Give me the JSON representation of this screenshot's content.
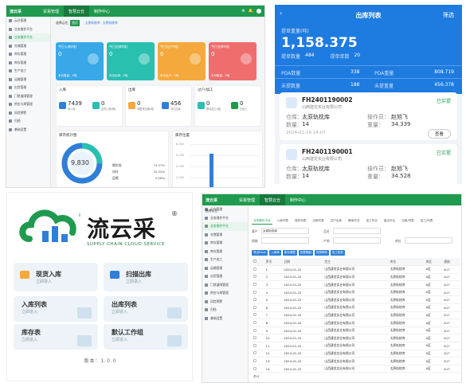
{
  "p1": {
    "logo": "流云采",
    "tabs": [
      "贸易管理",
      "智慧云仓",
      "制作中心"
    ],
    "breadcrumb": [
      "选择云仓",
      "首页"
    ],
    "wh_tabs": [
      "太原轨枕库",
      "太原轨枕库"
    ],
    "cards": [
      {
        "title": "今日入库(吨)",
        "value": "0",
        "sub": "本月数量：0吨",
        "color": "#38a8e8"
      },
      {
        "title": "今日出库(吨)",
        "value": "0",
        "sub": "本月出库：0吨",
        "color": "#29c0b0"
      },
      {
        "title": "今日出户(吨)",
        "value": "0",
        "sub": "本月出户：0吨",
        "color": "#f5a93c"
      },
      {
        "title": "今日仓库(吨)",
        "value": "0",
        "sub": "本月账量：0吨",
        "color": "#ee6e6e"
      }
    ],
    "sidebar": [
      "云仓管理",
      "业务操作平台",
      "业务操作平台",
      "仓储管理",
      "库存管理",
      "库存管理",
      "生产加工",
      "运输管理",
      "出货管理",
      "门禁道闸管理",
      "供应与周管理",
      "风险预警",
      "归档",
      "基础设置"
    ],
    "panels": [
      {
        "title": "入库",
        "stats": [
          {
            "v": "7439",
            "l": "待入库"
          },
          {
            "v": "0",
            "l": "交货入库(吨)"
          }
        ]
      },
      {
        "title": "出库",
        "stats": [
          {
            "v": "0",
            "l": "待提货出库(吨)"
          },
          {
            "v": "456",
            "l": "今日出库"
          }
        ]
      },
      {
        "title": "过户/加工",
        "stats": [
          {
            "v": "0",
            "l": "申请加工(吨)"
          },
          {
            "v": "0",
            "l": "已加工"
          }
        ]
      }
    ],
    "stock_title": "库存统计图",
    "stock_total": "9,830",
    "legend": [
      {
        "pct": "74.37%",
        "l": "螺纹钢"
      },
      {
        "pct": "25.54%",
        "l": "线材"
      },
      {
        "pct": "0.08%",
        "l": "盘螺"
      }
    ],
    "bar_title": "库存位置",
    "bar_ticks": [
      "8,000",
      "6,000",
      "4,000",
      "2,000"
    ]
  },
  "p2": {
    "title": "出库列表",
    "filter": "筛选",
    "weight_label": "提单重量(吨)",
    "weight": "1,158.375",
    "count_label": "提单数量",
    "count": "484",
    "sheets_label": "提单单数",
    "sheets": "20",
    "rows": [
      {
        "a_l": "PDA数量",
        "a": "338",
        "b_l": "PDA重量",
        "b": "808.719"
      },
      {
        "a_l": "未提数量",
        "a": "188",
        "b_l": "未提重量",
        "b": "456.378"
      }
    ],
    "records": [
      {
        "no": "FH2401190002",
        "status": "已实提",
        "company": "山西建龙实业有限公司",
        "wh_l": "仓库：",
        "wh": "太原轨枕库",
        "op_l": "操作员：",
        "op": "赵旭飞",
        "n_l": "数量：",
        "n": "14",
        "w_l": "重量：",
        "w": "34.339",
        "time": "2024-01-19 14:07",
        "btn": "查看"
      },
      {
        "no": "FH2401190001",
        "status": "已实提",
        "company": "山西建龙实业有限公司",
        "wh_l": "仓库：",
        "wh": "太原轨枕库",
        "op_l": "操作员：",
        "op": "赵旭飞",
        "n_l": "数量：",
        "n": "14",
        "w_l": "重量：",
        "w": "34.528"
      }
    ]
  },
  "p3": {
    "name": "流云采",
    "reg": "®",
    "tagline": "SUPPLY CHAIN CLOUD SERVICE",
    "tiles": [
      {
        "t": "现货入库",
        "s": "立即录入"
      },
      {
        "t": "扫描出库",
        "s": "立即录入"
      },
      {
        "t": "入库列表",
        "s": "立即进入"
      },
      {
        "t": "出库列表",
        "s": "立即进入"
      },
      {
        "t": "库存表",
        "s": "立即进入"
      },
      {
        "t": "默认工作组",
        "s": "立即进入"
      }
    ],
    "version": "版本：1.0.0"
  },
  "p4": {
    "logo": "流云采",
    "tabs": [
      "贸易管理",
      "智慧云仓",
      "制作中心"
    ],
    "sidebar": [
      "云仓管理",
      "业务操作平台",
      "业务操作平台",
      "仓储管理",
      "库存管理",
      "库存管理",
      "生产加工",
      "运输管理",
      "出货管理",
      "门禁道闸管理",
      "供应与周管理",
      "风险预警",
      "归档",
      "基础设置"
    ],
    "sel_wh": "选择云仓",
    "tabs2": [
      "业务操作平台",
      "入库列表",
      "库存列表",
      "出库列表",
      "过户出库",
      "移库作业",
      "加工作业",
      "盘点作业",
      "出库/列表",
      "加工/列表"
    ],
    "filters": [
      {
        "l": "客户",
        "v": "太原轨枕库"
      },
      {
        "l": "品名",
        "v": ""
      },
      {
        "l": "规格",
        "v": ""
      },
      {
        "l": "产地",
        "v": ""
      },
      {
        "l": "库位",
        "v": ""
      }
    ],
    "buttons": [
      "导出Excel",
      "入库单",
      "库存调整",
      "查看明细",
      "货物审核",
      "加工检查"
    ],
    "headers": [
      "",
      "序号",
      "日期",
      "货主",
      "库名",
      "库区",
      "规格"
    ],
    "rows": [
      [
        "1",
        "2024-01-22",
        "山西建龙实业有限公司",
        "太原轨枕库",
        "A区",
        "A17"
      ],
      [
        "2",
        "2024-01-22",
        "山西建龙实业有限公司",
        "太原轨枕库",
        "A区",
        "A17"
      ],
      [
        "3",
        "2024-01-22",
        "山西建龙实业有限公司",
        "太原轨枕库",
        "A区",
        "A17"
      ],
      [
        "4",
        "2024-01-22",
        "山西建龙实业有限公司",
        "太原轨枕库",
        "A区",
        "A17"
      ],
      [
        "5",
        "2024-01-22",
        "山西建龙实业有限公司",
        "太原轨枕库",
        "A区",
        "A17"
      ],
      [
        "6",
        "2024-01-22",
        "山西建龙实业有限公司",
        "太原轨枕库",
        "A区",
        "A17"
      ],
      [
        "7",
        "2024-01-22",
        "山西建龙实业有限公司",
        "太原轨枕库",
        "A区",
        "A17"
      ],
      [
        "8",
        "2024-01-22",
        "山西建龙实业有限公司",
        "太原轨枕库",
        "A区",
        "A17"
      ],
      [
        "9",
        "2024-01-22",
        "山西建龙实业有限公司",
        "太原轨枕库",
        "A区",
        "A17"
      ],
      [
        "10",
        "2024-01-22",
        "山西建龙实业有限公司",
        "太原轨枕库",
        "A区",
        "A17"
      ],
      [
        "11",
        "2024-01-22",
        "山西建龙实业有限公司",
        "太原轨枕库",
        "A区",
        "A17"
      ],
      [
        "12",
        "2024-01-22",
        "山西建龙实业有限公司",
        "太原轨枕库",
        "A区",
        "A17"
      ],
      [
        "13",
        "2024-01-22",
        "山西建龙实业有限公司",
        "太原轨枕库",
        "A区",
        "A17"
      ],
      [
        "14",
        "2024-01-22",
        "山西建龙实业有限公司",
        "太原轨枕库",
        "A区",
        "A17"
      ]
    ],
    "footer": "合计"
  }
}
